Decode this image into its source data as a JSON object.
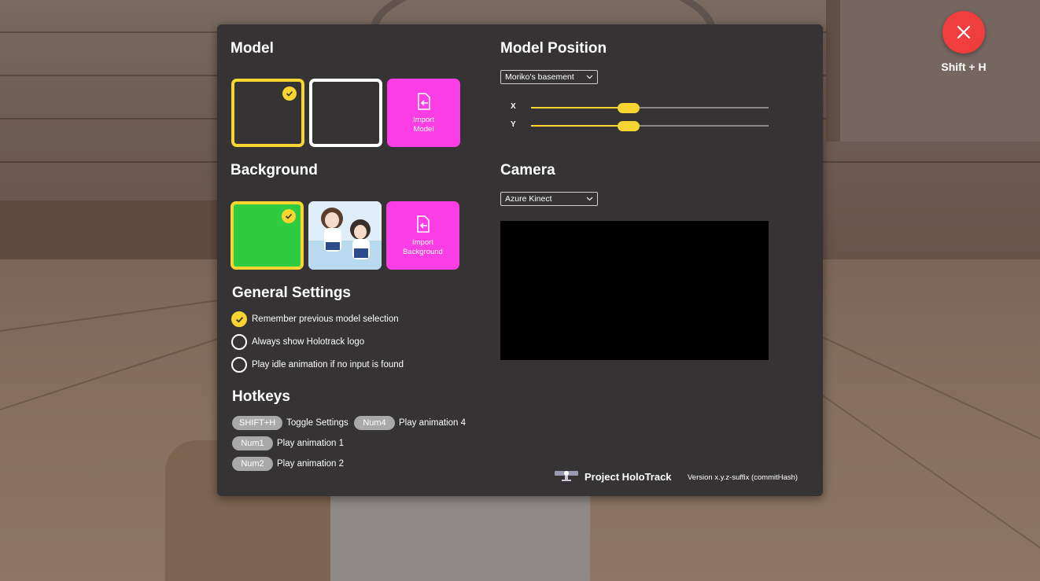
{
  "close": {
    "hint": "Shift + H"
  },
  "model": {
    "heading": "Model",
    "import_label_1": "Import",
    "import_label_2": "Model"
  },
  "background": {
    "heading": "Background",
    "import_label_1": "Import",
    "import_label_2": "Background",
    "green_color": "#2ecc40"
  },
  "general": {
    "heading": "General Settings",
    "options": [
      {
        "label": "Remember previous model selection",
        "checked": true
      },
      {
        "label": "Always show Holotrack logo",
        "checked": false
      },
      {
        "label": "Play idle animation if no input is found",
        "checked": false
      }
    ]
  },
  "hotkeys": {
    "heading": "Hotkeys",
    "items": [
      {
        "key": "SHIFT+H",
        "label": "Toggle Settings"
      },
      {
        "key": "Num1",
        "label": "Play animation 1"
      },
      {
        "key": "Num2",
        "label": "Play animation 2"
      },
      {
        "key": "Num4",
        "label": "Play animation 4"
      }
    ]
  },
  "model_position": {
    "heading": "Model Position",
    "location": "Moriko's basement",
    "x_label": "X",
    "y_label": "Y",
    "x_value": 0.41,
    "y_value": 0.41
  },
  "camera": {
    "heading": "Camera",
    "device": "Azure Kinect"
  },
  "footer": {
    "title": "Project HoloTrack",
    "version": "Version x.y.z-suffix (commitHash)"
  },
  "colors": {
    "accent": "#f8d531",
    "import": "#fa3de4",
    "close": "#f03e3e",
    "panel": "#353333"
  }
}
